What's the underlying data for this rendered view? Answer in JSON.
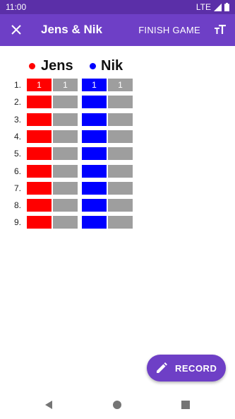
{
  "status_bar": {
    "time": "11:00",
    "network": "LTE"
  },
  "app_bar": {
    "title": "Jens & Nik",
    "finish_label": "FINISH GAME"
  },
  "players": [
    {
      "name": "Jens",
      "color": "#ff0000"
    },
    {
      "name": "Nik",
      "color": "#0000ff"
    }
  ],
  "rows": [
    {
      "number": "1.",
      "jens": [
        "1",
        "1"
      ],
      "nik": [
        "1",
        "1"
      ]
    },
    {
      "number": "2.",
      "jens": [
        "",
        ""
      ],
      "nik": [
        "",
        ""
      ]
    },
    {
      "number": "3.",
      "jens": [
        "",
        ""
      ],
      "nik": [
        "",
        ""
      ]
    },
    {
      "number": "4.",
      "jens": [
        "",
        ""
      ],
      "nik": [
        "",
        ""
      ]
    },
    {
      "number": "5.",
      "jens": [
        "",
        ""
      ],
      "nik": [
        "",
        ""
      ]
    },
    {
      "number": "6.",
      "jens": [
        "",
        ""
      ],
      "nik": [
        "",
        ""
      ]
    },
    {
      "number": "7.",
      "jens": [
        "",
        ""
      ],
      "nik": [
        "",
        ""
      ]
    },
    {
      "number": "8.",
      "jens": [
        "",
        ""
      ],
      "nik": [
        "",
        ""
      ]
    },
    {
      "number": "9.",
      "jens": [
        "",
        ""
      ],
      "nik": [
        "",
        ""
      ]
    }
  ],
  "empty_color": "#9e9e9e",
  "fab": {
    "label": "RECORD"
  }
}
